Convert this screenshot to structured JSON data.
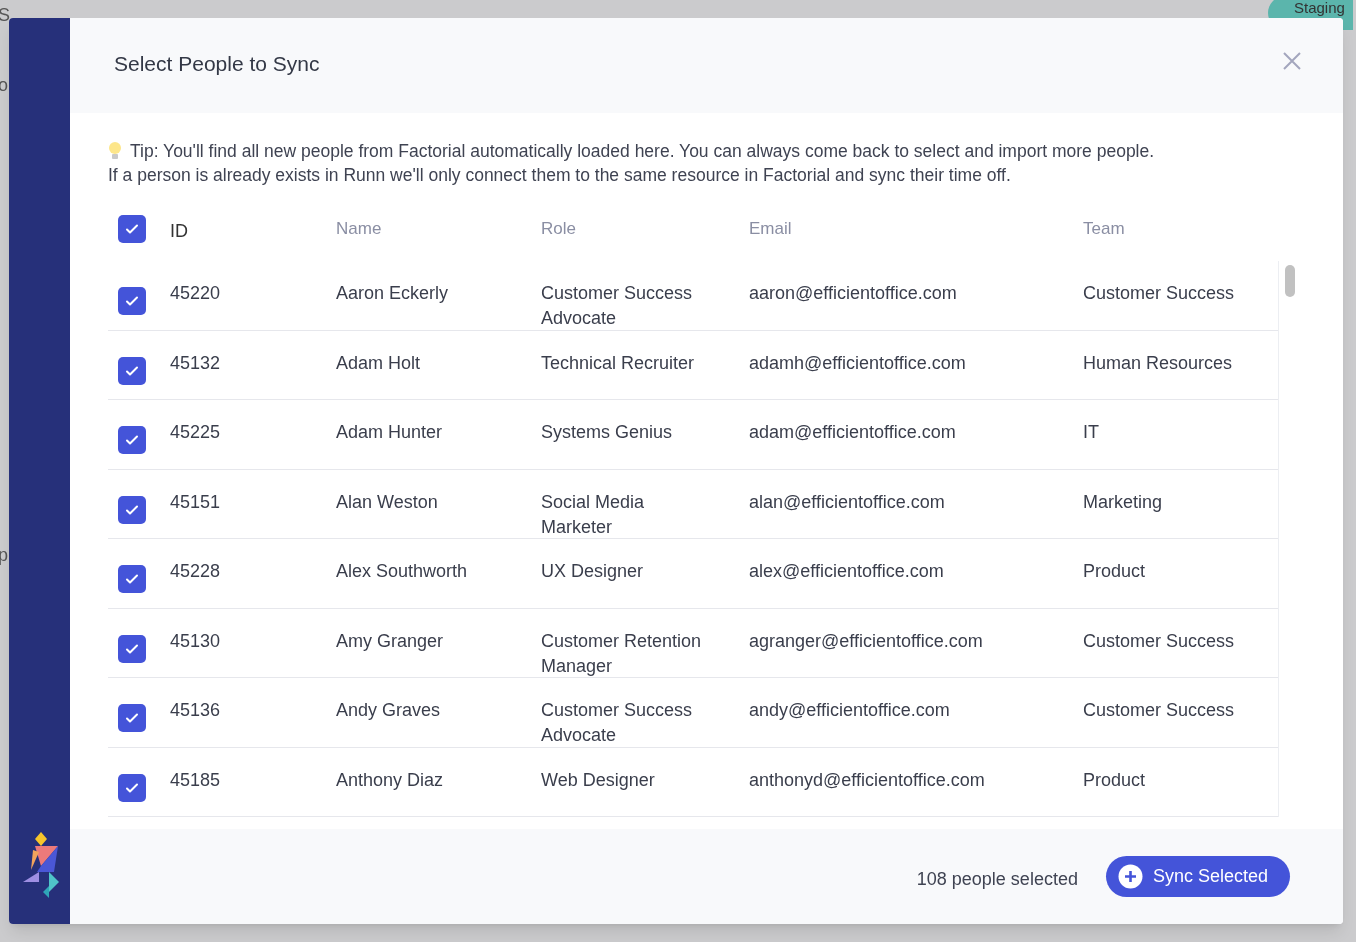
{
  "background": {
    "texts": [
      "S",
      "o",
      "p"
    ],
    "badge": "Staging"
  },
  "dialog": {
    "title": "Select People to Sync",
    "tip": "Tip: You'll find all new people from Factorial automatically loaded here. You can always come back to select and import more people.",
    "note": "If a person is already exists in Runn we'll only connect them to the same resource in Factorial and sync their time off."
  },
  "table": {
    "select_all": {
      "checked": true
    },
    "columns": [
      "ID",
      "Name",
      "Role",
      "Email",
      "Team"
    ],
    "rows": [
      {
        "checked": true,
        "cells": [
          "45220",
          "Aaron Eckerly",
          "Customer Success Advocate",
          "aaron@efficientoffice.com",
          "Customer Success"
        ]
      },
      {
        "checked": true,
        "cells": [
          "45132",
          "Adam Holt",
          "Technical Recruiter",
          "adamh@efficientoffice.com",
          "Human Resources"
        ]
      },
      {
        "checked": true,
        "cells": [
          "45225",
          "Adam Hunter",
          "Systems Genius",
          "adam@efficientoffice.com",
          "IT"
        ]
      },
      {
        "checked": true,
        "cells": [
          "45151",
          "Alan Weston",
          "Social Media Marketer",
          "alan@efficientoffice.com",
          "Marketing"
        ]
      },
      {
        "checked": true,
        "cells": [
          "45228",
          "Alex Southworth",
          "UX Designer",
          "alex@efficientoffice.com",
          "Product"
        ]
      },
      {
        "checked": true,
        "cells": [
          "45130",
          "Amy Granger",
          "Customer Retention Manager",
          "agranger@efficientoffice.com",
          "Customer Success"
        ]
      },
      {
        "checked": true,
        "cells": [
          "45136",
          "Andy Graves",
          "Customer Success Advocate",
          "andy@efficientoffice.com",
          "Customer Success"
        ]
      },
      {
        "checked": true,
        "cells": [
          "45185",
          "Anthony Diaz",
          "Web Designer",
          "anthonyd@efficientoffice.com",
          "Product"
        ]
      }
    ]
  },
  "footer": {
    "count": "108 people selected",
    "button": "Sync Selected"
  }
}
